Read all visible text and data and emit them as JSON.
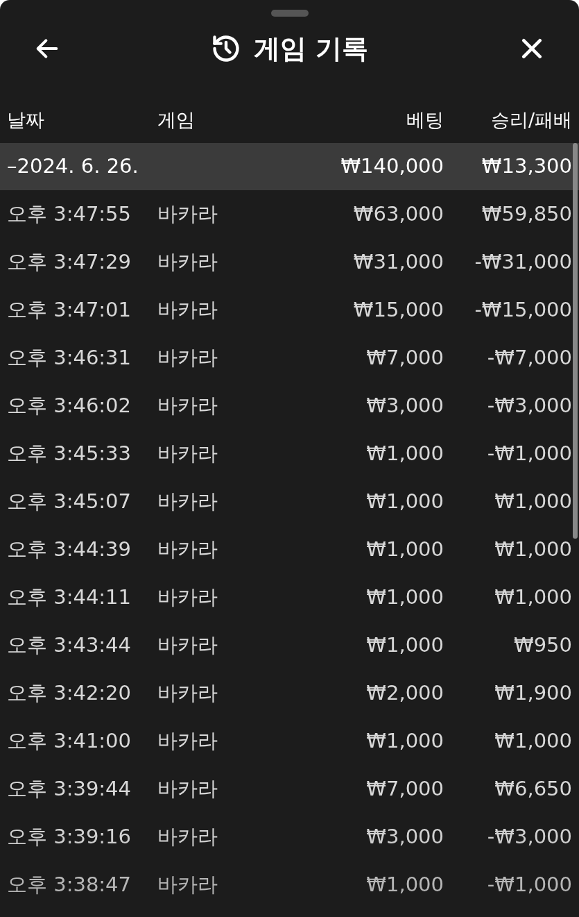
{
  "header": {
    "title": "게임 기록"
  },
  "columns": [
    "날짜",
    "게임",
    "베팅",
    "승리/패배"
  ],
  "date_group": {
    "date": "–2024. 6. 26.",
    "bet": "₩140,000",
    "result": "₩13,300"
  },
  "rows": [
    {
      "time": "오후 3:47:55",
      "game": "바카라",
      "bet": "₩63,000",
      "result": "₩59,850"
    },
    {
      "time": "오후 3:47:29",
      "game": "바카라",
      "bet": "₩31,000",
      "result": "-₩31,000"
    },
    {
      "time": "오후 3:47:01",
      "game": "바카라",
      "bet": "₩15,000",
      "result": "-₩15,000"
    },
    {
      "time": "오후 3:46:31",
      "game": "바카라",
      "bet": "₩7,000",
      "result": "-₩7,000"
    },
    {
      "time": "오후 3:46:02",
      "game": "바카라",
      "bet": "₩3,000",
      "result": "-₩3,000"
    },
    {
      "time": "오후 3:45:33",
      "game": "바카라",
      "bet": "₩1,000",
      "result": "-₩1,000"
    },
    {
      "time": "오후 3:45:07",
      "game": "바카라",
      "bet": "₩1,000",
      "result": "₩1,000"
    },
    {
      "time": "오후 3:44:39",
      "game": "바카라",
      "bet": "₩1,000",
      "result": "₩1,000"
    },
    {
      "time": "오후 3:44:11",
      "game": "바카라",
      "bet": "₩1,000",
      "result": "₩1,000"
    },
    {
      "time": "오후 3:43:44",
      "game": "바카라",
      "bet": "₩1,000",
      "result": "₩950"
    },
    {
      "time": "오후 3:42:20",
      "game": "바카라",
      "bet": "₩2,000",
      "result": "₩1,900"
    },
    {
      "time": "오후 3:41:00",
      "game": "바카라",
      "bet": "₩1,000",
      "result": "₩1,000"
    },
    {
      "time": "오후 3:39:44",
      "game": "바카라",
      "bet": "₩7,000",
      "result": "₩6,650"
    },
    {
      "time": "오후 3:39:16",
      "game": "바카라",
      "bet": "₩3,000",
      "result": "-₩3,000"
    },
    {
      "time": "오후 3:38:47",
      "game": "바카라",
      "bet": "₩1,000",
      "result": "-₩1,000"
    }
  ]
}
